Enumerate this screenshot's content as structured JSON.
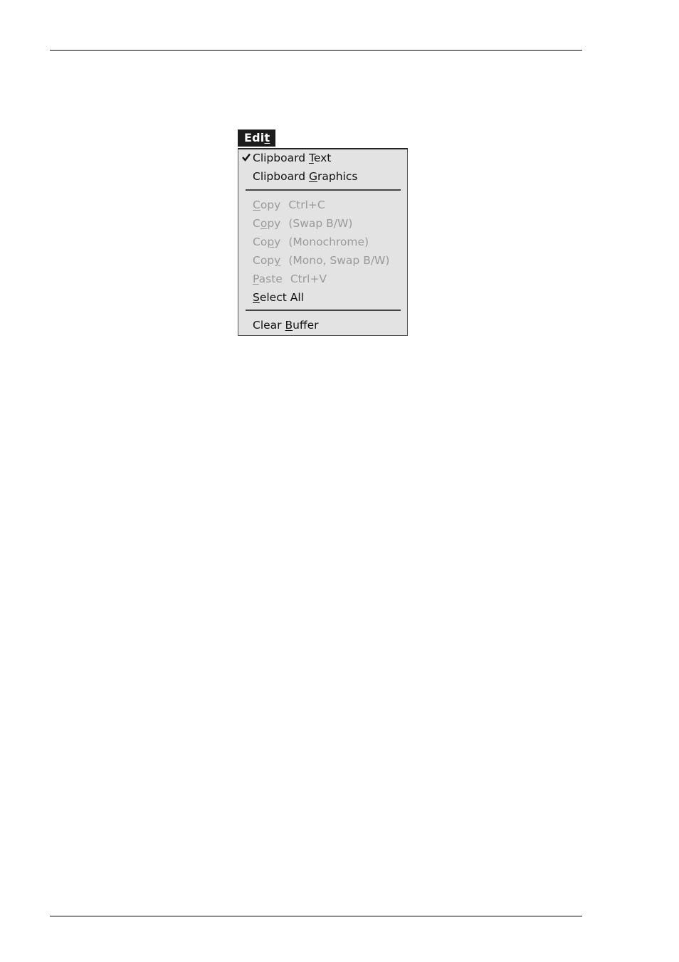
{
  "menu": {
    "title_pre": "Edi",
    "title_mnemonic": "t",
    "items": [
      {
        "pre": "Clipboard ",
        "mn": "T",
        "post": "ext",
        "shortcut": "",
        "checked": true,
        "enabled": true
      },
      {
        "pre": "Clipboard ",
        "mn": "G",
        "post": "raphics",
        "shortcut": "",
        "checked": false,
        "enabled": true
      },
      {
        "pre": "",
        "mn": "C",
        "post": "opy",
        "shortcut": "Ctrl+C",
        "checked": false,
        "enabled": false
      },
      {
        "pre": "C",
        "mn": "o",
        "post": "py",
        "shortcut": "(Swap B/W)",
        "checked": false,
        "enabled": false
      },
      {
        "pre": "Co",
        "mn": "p",
        "post": "y",
        "shortcut": "(Monochrome)",
        "checked": false,
        "enabled": false
      },
      {
        "pre": "Cop",
        "mn": "y",
        "post": "",
        "shortcut": "(Mono, Swap B/W)",
        "checked": false,
        "enabled": false
      },
      {
        "pre": "",
        "mn": "P",
        "post": "aste",
        "shortcut": "Ctrl+V",
        "checked": false,
        "enabled": false
      },
      {
        "pre": "",
        "mn": "S",
        "post": "elect All",
        "shortcut": "",
        "checked": false,
        "enabled": true
      },
      {
        "pre": "Clear ",
        "mn": "B",
        "post": "uffer",
        "shortcut": "",
        "checked": false,
        "enabled": true
      }
    ]
  }
}
